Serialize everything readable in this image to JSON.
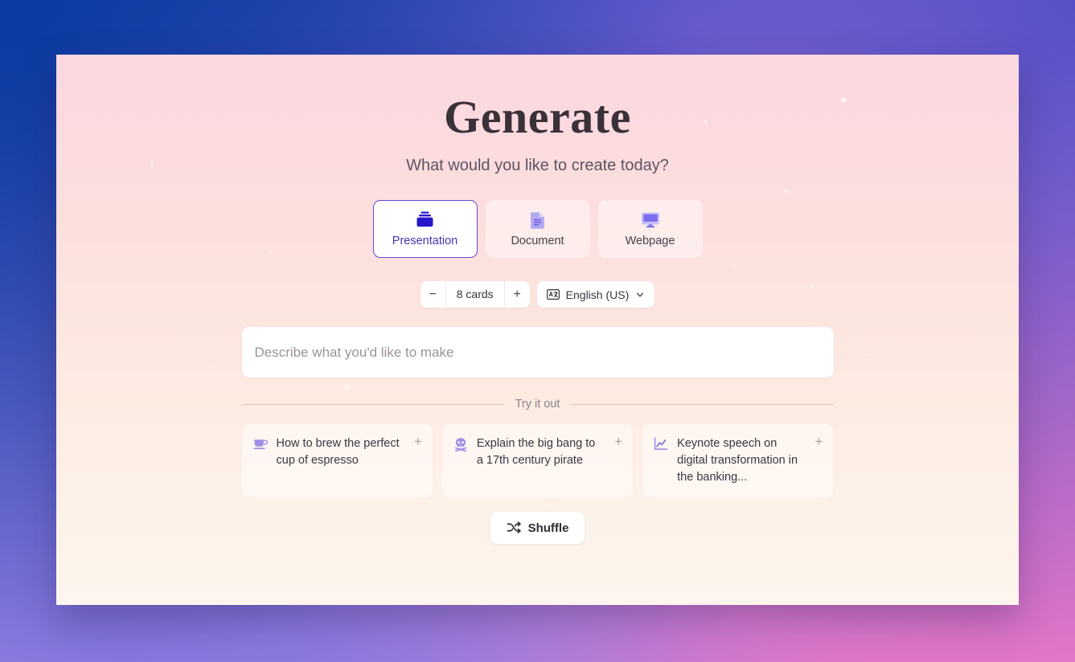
{
  "page": {
    "title": "Generate",
    "subtitle": "What would you like to create today?"
  },
  "type_selector": {
    "options": [
      {
        "label": "Presentation",
        "icon": "presentation-icon",
        "selected": true
      },
      {
        "label": "Document",
        "icon": "document-icon",
        "selected": false
      },
      {
        "label": "Webpage",
        "icon": "webpage-icon",
        "selected": false
      }
    ]
  },
  "options_row": {
    "decrement_label": "−",
    "increment_label": "+",
    "card_count_label": "8 cards",
    "language_label": "English (US)",
    "language_icon": "translate-icon",
    "chevron_icon": "chevron-down-icon"
  },
  "prompt": {
    "value": "",
    "placeholder": "Describe what you'd like to make"
  },
  "divider": {
    "label": "Try it out"
  },
  "suggestions": [
    {
      "text": "How to brew the perfect cup of espresso",
      "icon": "coffee-cup-icon",
      "add_label": "+"
    },
    {
      "text": "Explain the big bang to a 17th century pirate",
      "icon": "skull-crossbones-icon",
      "add_label": "+"
    },
    {
      "text": "Keynote speech on digital transformation in the banking...",
      "icon": "line-chart-icon",
      "add_label": "+"
    }
  ],
  "shuffle": {
    "label": "Shuffle",
    "icon": "shuffle-icon"
  },
  "colors": {
    "accent": "#6d45d8",
    "accent_text": "#4a32b8",
    "icon_light_purple": "#a89bf0",
    "panel_top": "#fbd7e0",
    "panel_bottom": "#fdf5ee",
    "text_primary": "#3b3640",
    "text_muted": "#8a8189"
  }
}
